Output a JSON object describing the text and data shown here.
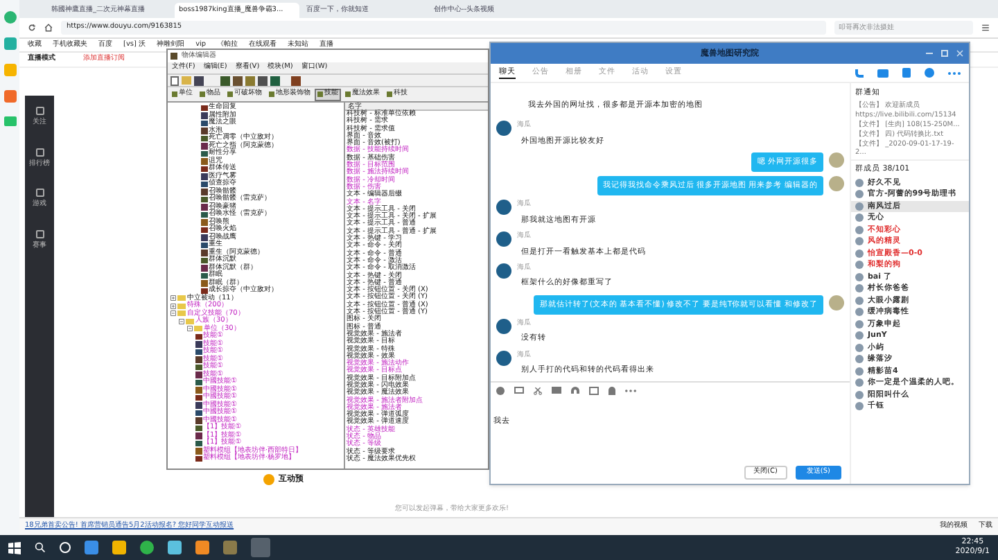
{
  "browser": {
    "tabs": [
      {
        "label": "韩國神鷹直播_二次元神幕直播",
        "selected": false
      },
      {
        "label": "boss1987king直播_魔兽争霸3...",
        "selected": true
      },
      {
        "label": "百度一下，你就知道",
        "selected": false
      },
      {
        "label": "创作中心--头条视频",
        "selected": false
      }
    ],
    "url": "https://www.douyu.com/9163815",
    "search_placeholder": "叩哥再次非法摄娃",
    "bookmarks": [
      "收藏",
      "手机收藏夹",
      "百度",
      "[vs] 沃",
      "神雕剑阳",
      "vip",
      "《帕拉",
      "在线观看",
      "未知站",
      "直播"
    ],
    "mode_label": "直播模式",
    "subscribe_label": "添加直播订阅"
  },
  "site_sidebar": [
    {
      "label": "关注"
    },
    {
      "label": "排行榜"
    },
    {
      "label": "游戏"
    },
    {
      "label": "赛事"
    }
  ],
  "editor": {
    "title": "物体编辑器",
    "menu": [
      "文件(F)",
      "编辑(E)",
      "察看(V)",
      "模块(M)",
      "窗口(W)"
    ],
    "tabs": [
      {
        "label": "单位",
        "selected": false
      },
      {
        "label": "物品",
        "selected": false
      },
      {
        "label": "可破坏物",
        "selected": false
      },
      {
        "label": "地形装饰物",
        "selected": false
      },
      {
        "label": "技能",
        "selected": true
      },
      {
        "label": "魔法效果",
        "selected": false
      },
      {
        "label": "科技",
        "selected": false
      }
    ],
    "tree": {
      "upper_items": [
        {
          "label": "生命回复",
          "modified": false
        },
        {
          "label": "属性附加",
          "modified": false
        },
        {
          "label": "魔法之眼",
          "modified": false
        },
        {
          "label": "水泡",
          "modified": false
        },
        {
          "label": "死亡凋零（中立敌对）",
          "modified": false
        },
        {
          "label": "死亡之指（阿克蒙德）",
          "modified": false
        },
        {
          "label": "耐性分享",
          "modified": false
        },
        {
          "label": "诅咒",
          "modified": false
        },
        {
          "label": "群体传送",
          "modified": false
        },
        {
          "label": "医疗气雾",
          "modified": false
        },
        {
          "label": "侦查掠夺",
          "modified": false
        },
        {
          "label": "召唤骷髅",
          "modified": false
        },
        {
          "label": "召唤骷髅（雷克萨）",
          "modified": false
        },
        {
          "label": "召唤豪猪",
          "modified": false
        },
        {
          "label": "召唤水怪（雷克萨）",
          "modified": false
        },
        {
          "label": "召唤熊",
          "modified": false
        },
        {
          "label": "召唤火焰",
          "modified": false
        },
        {
          "label": "召唤战鹰",
          "modified": false
        },
        {
          "label": "重生",
          "modified": false
        },
        {
          "label": "重生（阿克蒙德）",
          "modified": false
        },
        {
          "label": "群体沉默",
          "modified": false
        },
        {
          "label": "群体沉默（群）",
          "modified": false
        },
        {
          "label": "群眠",
          "modified": false
        },
        {
          "label": "群眠（群）",
          "modified": false
        },
        {
          "label": "成长掠夺（中立敌对）",
          "modified": false
        }
      ],
      "nodes": [
        {
          "label": "中立被动（11）",
          "modified": false,
          "expanded": false
        },
        {
          "label": "特殊（200）",
          "modified": true,
          "expanded": false
        },
        {
          "label": "自定义技能（70）",
          "modified": true,
          "expanded": true,
          "children": [
            {
              "label": "人族（30）",
              "modified": true,
              "expanded": true,
              "children": [
                {
                  "label": "单位（30）",
                  "modified": true,
                  "expanded": true,
                  "children": [
                    {
                      "label": "技能①",
                      "modified": true
                    },
                    {
                      "label": "技能①",
                      "modified": true
                    },
                    {
                      "label": "技能①",
                      "modified": true
                    },
                    {
                      "label": "技能①",
                      "modified": true
                    },
                    {
                      "label": "技能①",
                      "modified": true
                    },
                    {
                      "label": "技能①",
                      "modified": true
                    },
                    {
                      "label": "中國技能①",
                      "modified": true
                    },
                    {
                      "label": "中國技能①",
                      "modified": true
                    },
                    {
                      "label": "中國技能①",
                      "modified": true
                    },
                    {
                      "label": "中國技能①",
                      "modified": true
                    },
                    {
                      "label": "中國技能①",
                      "modified": true
                    },
                    {
                      "label": "中國技能①",
                      "modified": true
                    },
                    {
                      "label": "【1】技能①",
                      "modified": true
                    },
                    {
                      "label": "【1】技能①",
                      "modified": true
                    },
                    {
                      "label": "【1】技能①",
                      "modified": true
                    },
                    {
                      "label": "塑料模组【地表坊伴·西部特日】",
                      "modified": true
                    },
                    {
                      "label": "塑料模组【地表坊伴·杨罗地】",
                      "modified": true
                    }
                  ]
                }
              ]
            }
          ]
        }
      ]
    },
    "list_header": "名字",
    "list": [
      {
        "label": "科技树 - 标准单位依赖",
        "modified": false
      },
      {
        "label": "科技树 - 需求",
        "modified": false
      },
      {
        "label": "科技树 - 需求值",
        "modified": false
      },
      {
        "label": "界面 - 音效",
        "modified": false
      },
      {
        "label": "界面 - 音效(被打)",
        "modified": false
      },
      {
        "label": "数据 - 技能持续时间",
        "modified": true
      },
      {
        "label": "数据 - 基础伤害",
        "modified": false
      },
      {
        "label": "数据 - 目标范围",
        "modified": true
      },
      {
        "label": "数据 - 施法持续时间",
        "modified": true
      },
      {
        "label": "数据 - 冷却时间",
        "modified": true
      },
      {
        "label": "数据 - 伤害",
        "modified": true
      },
      {
        "label": "文本 - 编辑器后缀",
        "modified": false
      },
      {
        "label": "文本 - 名字",
        "modified": true
      },
      {
        "label": "文本 - 提示工具 - 关闭",
        "modified": false
      },
      {
        "label": "文本 - 提示工具 - 关闭 - 扩展",
        "modified": false
      },
      {
        "label": "文本 - 提示工具 - 普通",
        "modified": false
      },
      {
        "label": "文本 - 提示工具 - 普通 - 扩展",
        "modified": false
      },
      {
        "label": "文本 - 热键 - 学习",
        "modified": false
      },
      {
        "label": "文本 - 命令 - 关闭",
        "modified": false
      },
      {
        "label": "文本 - 命令 - 普通",
        "modified": false
      },
      {
        "label": "文本 - 命令 - 激活",
        "modified": false
      },
      {
        "label": "文本 - 命令 - 取消激活",
        "modified": false
      },
      {
        "label": "文本 - 热键 - 关闭",
        "modified": false
      },
      {
        "label": "文本 - 热键 - 普通",
        "modified": false
      },
      {
        "label": "文本 - 按钮位置 - 关闭 (X)",
        "modified": false
      },
      {
        "label": "文本 - 按钮位置 - 关闭 (Y)",
        "modified": false
      },
      {
        "label": "文本 - 按钮位置 - 普通 (X)",
        "modified": false
      },
      {
        "label": "文本 - 按钮位置 - 普通 (Y)",
        "modified": false
      },
      {
        "label": "图标 - 关闭",
        "modified": false
      },
      {
        "label": "图标 - 普通",
        "modified": false
      },
      {
        "label": "视觉效果 - 施法者",
        "modified": false
      },
      {
        "label": "视觉效果 - 目标",
        "modified": false
      },
      {
        "label": "视觉效果 - 特殊",
        "modified": false
      },
      {
        "label": "视觉效果 - 效果",
        "modified": false
      },
      {
        "label": "视觉效果 - 施法动作",
        "modified": true
      },
      {
        "label": "视觉效果 - 目标点",
        "modified": true
      },
      {
        "label": "视觉效果 - 目标附加点",
        "modified": false
      },
      {
        "label": "视觉效果 - 闪电效果",
        "modified": false
      },
      {
        "label": "视觉效果 - 魔法效果",
        "modified": false
      },
      {
        "label": "视觉效果 - 施法者附加点",
        "modified": true
      },
      {
        "label": "视觉效果 - 施法者",
        "modified": true
      },
      {
        "label": "视觉效果 - 弹道弧度",
        "modified": false
      },
      {
        "label": "视觉效果 - 弹道速度",
        "modified": false
      },
      {
        "label": "状态 - 英雄技能",
        "modified": true
      },
      {
        "label": "状态 - 物品",
        "modified": true
      },
      {
        "label": "状态 - 等级",
        "modified": true
      },
      {
        "label": "状态 - 等级要求",
        "modified": false
      },
      {
        "label": "状态 - 魔法效果优先权",
        "modified": false
      }
    ]
  },
  "chat": {
    "title": "魔兽地图研究院",
    "tabs": [
      {
        "label": "聊天",
        "selected": true
      },
      {
        "label": "公告",
        "selected": false
      },
      {
        "label": "相册",
        "selected": false
      },
      {
        "label": "文件",
        "selected": false
      },
      {
        "label": "活动",
        "selected": false
      },
      {
        "label": "设置",
        "selected": false
      }
    ],
    "messages": [
      {
        "kind": "continued",
        "text": "我去外国的网址找，很多都是开源本加密的地图"
      },
      {
        "kind": "incoming",
        "sender": "海瓜",
        "text": "外国地图开源比较友好"
      },
      {
        "kind": "outgoing",
        "text": "嗯 外网开源很多"
      },
      {
        "kind": "outgoing",
        "text": "我记得我找命令乘风过后 很多开源地图 用来参考 编辑器的"
      },
      {
        "kind": "incoming",
        "sender": "海瓜",
        "text": "那我就这地图有开源"
      },
      {
        "kind": "incoming",
        "sender": "海瓜",
        "text": "但是打开一看触发基本上都是代码"
      },
      {
        "kind": "incoming",
        "sender": "海瓜",
        "text": "框架什么的好像都重写了"
      },
      {
        "kind": "outgoing",
        "text": "那就估计转了(文本的 基本看不懂) 修改不了 要是纯T你就可以看懂 和修改了"
      },
      {
        "kind": "incoming",
        "sender": "海瓜",
        "text": "没有转"
      },
      {
        "kind": "incoming",
        "sender": "海瓜",
        "text": "别人手打的代码和转的代码看得出来"
      }
    ],
    "input_value": "我去",
    "close_button": "关闭(C)",
    "send_button": "发送(S)",
    "notice_title": "群通知",
    "notices": [
      "【公告】 欢迎新成员",
      "https://live.bilibili.com/15134",
      "【文件】 [生肉] 108(15-250M...",
      "【文件】 四) 代码转换比.txt",
      "【文件】 _2020-09-01-17-19-2..."
    ],
    "members_title": "群成员 38/101",
    "members": [
      {
        "name": "好久不见",
        "selected": false,
        "color": "#333333"
      },
      {
        "name": "官方-阿蕾的99号助理书",
        "selected": false,
        "color": "#333333"
      },
      {
        "name": "南风过后",
        "selected": true,
        "color": "#333333"
      },
      {
        "name": "无心",
        "selected": false,
        "color": "#333333"
      },
      {
        "name": "不知彩心",
        "selected": false,
        "color": "#e02c2c"
      },
      {
        "name": "风的精灵",
        "selected": false,
        "color": "#e02c2c"
      },
      {
        "name": "怡宣殿香—0-0",
        "selected": false,
        "color": "#e02c2c"
      },
      {
        "name": "和梨的狗",
        "selected": false,
        "color": "#e02c2c"
      },
      {
        "name": "bai 了",
        "selected": false,
        "color": "#333333"
      },
      {
        "name": "村长你爸爸",
        "selected": false,
        "color": "#333333"
      },
      {
        "name": "大眼小露剧",
        "selected": false,
        "color": "#333333"
      },
      {
        "name": "缓冲病毒性",
        "selected": false,
        "color": "#333333"
      },
      {
        "name": "万象申起",
        "selected": false,
        "color": "#333333"
      },
      {
        "name": "JunY",
        "selected": false,
        "color": "#333333"
      },
      {
        "name": "小屿",
        "selected": false,
        "color": "#333333"
      },
      {
        "name": "缘落汐",
        "selected": false,
        "color": "#333333"
      },
      {
        "name": "精影苗4",
        "selected": false,
        "color": "#333333"
      },
      {
        "name": "你一定是个温柔的人吧。",
        "selected": false,
        "color": "#333333"
      },
      {
        "name": "阳阳叫什么",
        "selected": false,
        "color": "#333333"
      },
      {
        "name": "千钰",
        "selected": false,
        "color": "#333333"
      }
    ]
  },
  "page": {
    "interaction_title": "互动预",
    "headline": "18兄弟首卖公告! 首席营销员通告5月2活动报名? 您好同学互动报送",
    "comment_hint": "您可以发起弹幕，带给大家更多欢乐!",
    "history_link": "我的视频",
    "download_link": "下载"
  },
  "taskbar": {
    "time": "22:45",
    "date": "2020/9/1"
  }
}
